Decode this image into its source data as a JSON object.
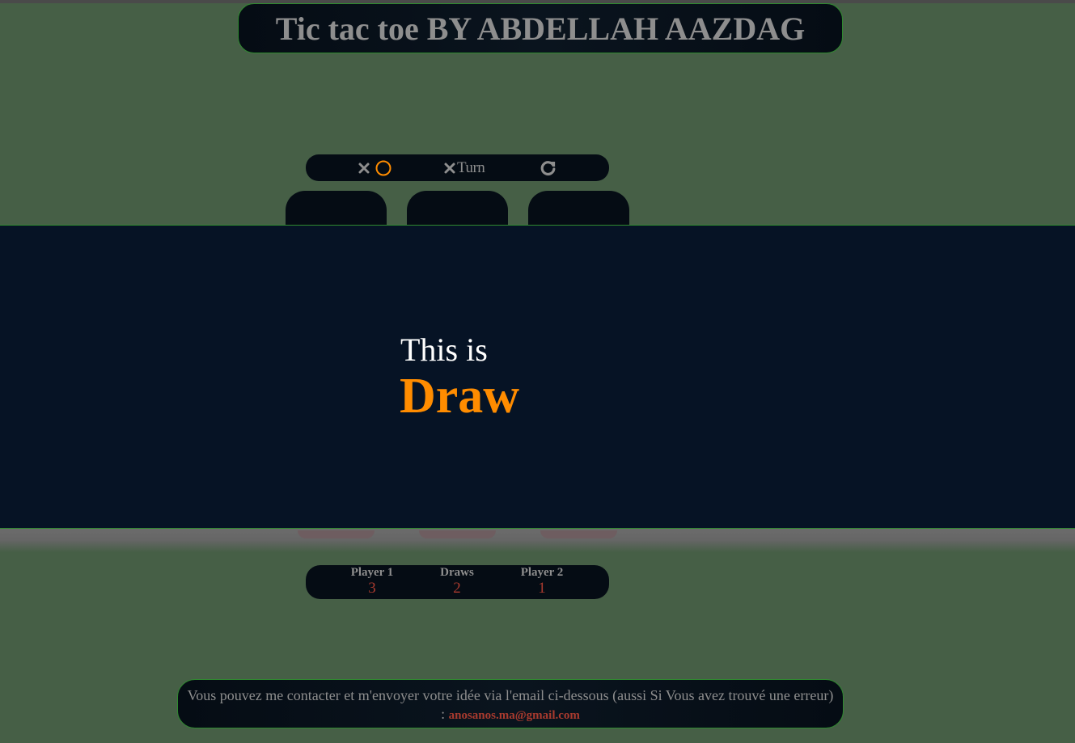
{
  "header": {
    "title": "Tic tac toe BY ABDELLAH AAZDAG"
  },
  "controls": {
    "symbols_icons": [
      "x-icon",
      "o-ring-icon"
    ],
    "turn_label": "Turn",
    "turn_icon": "x-icon",
    "restart_icon": "restart-icon"
  },
  "overlay": {
    "prefix": "This is",
    "result": "Draw"
  },
  "score": {
    "player1_label": "Player 1",
    "player1_value": "3",
    "draws_label": "Draws",
    "draws_value": "2",
    "player2_label": "Player 2",
    "player2_value": "1"
  },
  "footer": {
    "text": "Vous pouvez me contacter et m'envoyer votre idée via l'email ci-dessous (aussi Si Vous avez trouvé une erreur) :",
    "email": "anosanos.ma@gmail.com"
  },
  "colors": {
    "background": "#465f46",
    "panel": "#050c14",
    "overlay": "#061325",
    "accent_orange": "#ff8c00",
    "score_red": "#a83a2e",
    "muted_text": "#8e8e8e"
  }
}
